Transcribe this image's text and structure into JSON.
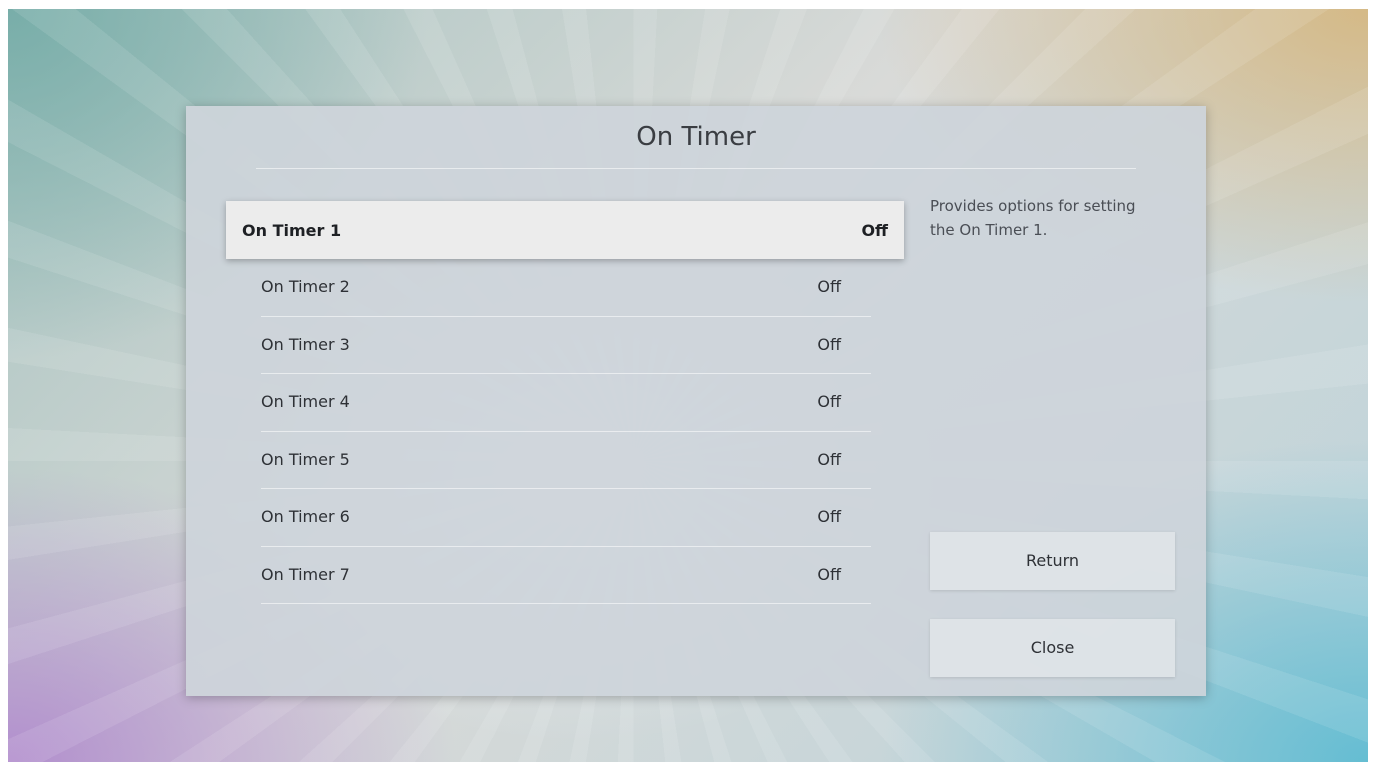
{
  "dialog": {
    "title": "On Timer",
    "description": "Provides options for setting the On Timer 1."
  },
  "timers": [
    {
      "label": "On Timer 1",
      "value": "Off",
      "focused": true
    },
    {
      "label": "On Timer 2",
      "value": "Off"
    },
    {
      "label": "On Timer 3",
      "value": "Off"
    },
    {
      "label": "On Timer 4",
      "value": "Off"
    },
    {
      "label": "On Timer 5",
      "value": "Off"
    },
    {
      "label": "On Timer 6",
      "value": "Off"
    },
    {
      "label": "On Timer 7",
      "value": "Off"
    }
  ],
  "buttons": {
    "return_label": "Return",
    "close_label": "Close"
  }
}
